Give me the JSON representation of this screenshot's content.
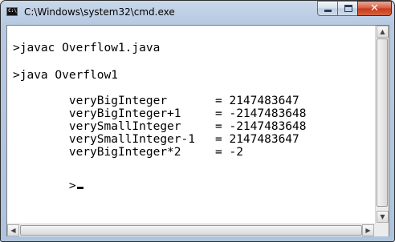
{
  "window": {
    "title": "C:\\Windows\\system32\\cmd.exe",
    "app_icon_text": "C:\\"
  },
  "titlebar": {
    "minimize_glyph": "",
    "maximize_glyph": "",
    "close_glyph": "✕"
  },
  "console": {
    "command1": ">javac Overflow1.java",
    "command2": ">java Overflow1",
    "output": [
      {
        "label": "veryBigInteger",
        "value": "= 2147483647"
      },
      {
        "label": "veryBigInteger+1",
        "value": "= -2147483648"
      },
      {
        "label": "verySmallInteger",
        "value": "= -2147483648"
      },
      {
        "label": "verySmallInteger-1",
        "value": "= 2147483647"
      },
      {
        "label": "veryBigInteger*2",
        "value": "= -2"
      }
    ],
    "prompt": ">"
  },
  "scrollbars": {
    "up_arrow": "▲",
    "down_arrow": "▼",
    "left_arrow": "◀",
    "right_arrow": "▶"
  }
}
